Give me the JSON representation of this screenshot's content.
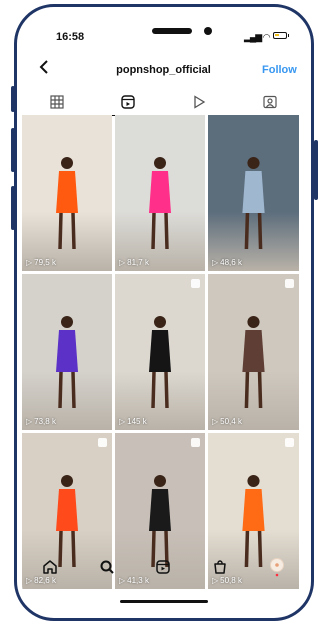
{
  "status": {
    "time": "16:58"
  },
  "header": {
    "username": "popnshop_official",
    "follow_label": "Follow"
  },
  "tabs": [
    {
      "name": "grid-icon",
      "active": false
    },
    {
      "name": "reels-icon",
      "active": true
    },
    {
      "name": "play-icon",
      "active": false
    },
    {
      "name": "tagged-icon",
      "active": false
    }
  ],
  "reels": [
    {
      "views": "79,5 k",
      "bg": "#e9e2d9",
      "figure": "#ff5a10",
      "shop": false
    },
    {
      "views": "81,7 k",
      "bg": "#dcdcd8",
      "figure": "#ff2f8a",
      "shop": false
    },
    {
      "views": "48,6 k",
      "bg": "#5c6d7c",
      "figure": "#9fb8d0",
      "shop": false
    },
    {
      "views": "73,8 k",
      "bg": "#d5d2cc",
      "figure": "#5b31c8",
      "shop": false
    },
    {
      "views": "145 k",
      "bg": "#dcd8d0",
      "figure": "#151515",
      "shop": true
    },
    {
      "views": "50,4 k",
      "bg": "#cfc8be",
      "figure": "#5f3f35",
      "shop": true
    },
    {
      "views": "82,6 k",
      "bg": "#d8d0c4",
      "figure": "#ff4a1c",
      "shop": true
    },
    {
      "views": "41,3 k",
      "bg": "#c8c0b8",
      "figure": "#1a1a1a",
      "shop": true
    },
    {
      "views": "50,8 k",
      "bg": "#e4ddd2",
      "figure": "#ff6a14",
      "shop": true
    }
  ],
  "nav": [
    {
      "name": "home-icon"
    },
    {
      "name": "search-icon"
    },
    {
      "name": "reels-nav-icon"
    },
    {
      "name": "shop-icon"
    },
    {
      "name": "profile-avatar"
    }
  ],
  "colors": {
    "accent": "#3897f0",
    "frame": "#1f3566"
  }
}
